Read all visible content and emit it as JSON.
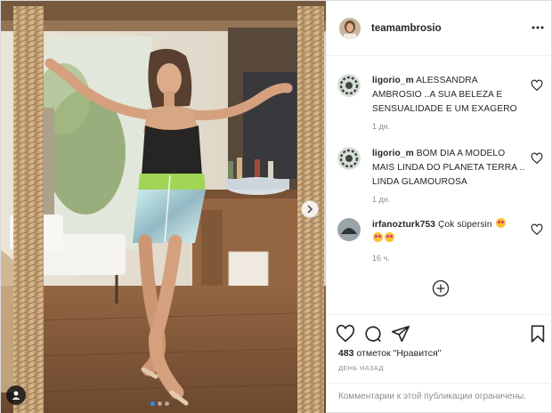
{
  "post": {
    "username": "teamambrosio",
    "comments": [
      {
        "user": "ligorio_m",
        "text": "ALESSANDRA AMBROSIO ..A SUA BELEZA E SENSUALIDADE E UM EXAGERO",
        "time": "1 дн."
      },
      {
        "user": "ligorio_m",
        "text": "BOM DIA A MODELO MAIS LINDA DO PLANETA TERRA .. LINDA GLAMOUROSA",
        "time": "1 дн."
      },
      {
        "user": "irfanozturk753",
        "text": "Çok süpersin",
        "time": "16 ч."
      }
    ],
    "likes_count": "483",
    "likes_text": "отметок \"Нравится\"",
    "date": "ДЕНЬ НАЗАД",
    "comments_closed": "Комментарии к этой публикации ограничены."
  },
  "photo": {
    "slide_count": 3,
    "active_slide": 1
  },
  "icons": {
    "more": "more-options-icon",
    "like": "heart-icon",
    "comment": "comment-icon",
    "share": "share-icon",
    "save": "bookmark-icon",
    "load_more": "plus-circle-icon",
    "next": "chevron-right-icon",
    "tags": "user-tag-icon"
  },
  "colors": {
    "text": "#262626",
    "muted": "#8e8e8e",
    "border": "#efefef",
    "accent": "#2f8dff"
  }
}
